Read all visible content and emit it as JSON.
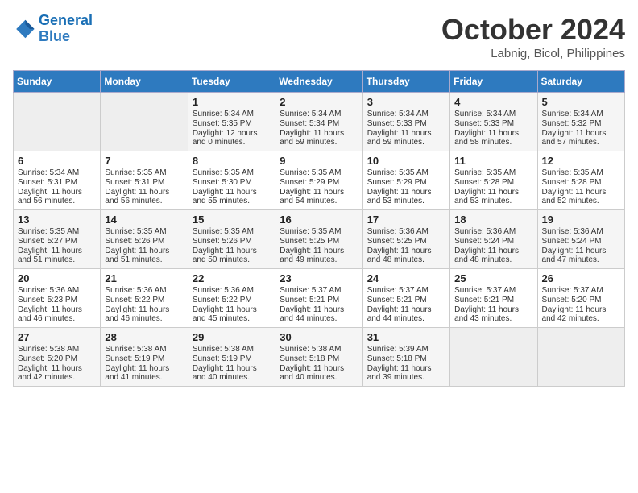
{
  "header": {
    "logo_line1": "General",
    "logo_line2": "Blue",
    "month": "October 2024",
    "location": "Labnig, Bicol, Philippines"
  },
  "weekdays": [
    "Sunday",
    "Monday",
    "Tuesday",
    "Wednesday",
    "Thursday",
    "Friday",
    "Saturday"
  ],
  "weeks": [
    [
      {
        "day": "",
        "info": ""
      },
      {
        "day": "",
        "info": ""
      },
      {
        "day": "1",
        "info": "Sunrise: 5:34 AM\nSunset: 5:35 PM\nDaylight: 12 hours and 0 minutes."
      },
      {
        "day": "2",
        "info": "Sunrise: 5:34 AM\nSunset: 5:34 PM\nDaylight: 11 hours and 59 minutes."
      },
      {
        "day": "3",
        "info": "Sunrise: 5:34 AM\nSunset: 5:33 PM\nDaylight: 11 hours and 59 minutes."
      },
      {
        "day": "4",
        "info": "Sunrise: 5:34 AM\nSunset: 5:33 PM\nDaylight: 11 hours and 58 minutes."
      },
      {
        "day": "5",
        "info": "Sunrise: 5:34 AM\nSunset: 5:32 PM\nDaylight: 11 hours and 57 minutes."
      }
    ],
    [
      {
        "day": "6",
        "info": "Sunrise: 5:34 AM\nSunset: 5:31 PM\nDaylight: 11 hours and 56 minutes."
      },
      {
        "day": "7",
        "info": "Sunrise: 5:35 AM\nSunset: 5:31 PM\nDaylight: 11 hours and 56 minutes."
      },
      {
        "day": "8",
        "info": "Sunrise: 5:35 AM\nSunset: 5:30 PM\nDaylight: 11 hours and 55 minutes."
      },
      {
        "day": "9",
        "info": "Sunrise: 5:35 AM\nSunset: 5:29 PM\nDaylight: 11 hours and 54 minutes."
      },
      {
        "day": "10",
        "info": "Sunrise: 5:35 AM\nSunset: 5:29 PM\nDaylight: 11 hours and 53 minutes."
      },
      {
        "day": "11",
        "info": "Sunrise: 5:35 AM\nSunset: 5:28 PM\nDaylight: 11 hours and 53 minutes."
      },
      {
        "day": "12",
        "info": "Sunrise: 5:35 AM\nSunset: 5:28 PM\nDaylight: 11 hours and 52 minutes."
      }
    ],
    [
      {
        "day": "13",
        "info": "Sunrise: 5:35 AM\nSunset: 5:27 PM\nDaylight: 11 hours and 51 minutes."
      },
      {
        "day": "14",
        "info": "Sunrise: 5:35 AM\nSunset: 5:26 PM\nDaylight: 11 hours and 51 minutes."
      },
      {
        "day": "15",
        "info": "Sunrise: 5:35 AM\nSunset: 5:26 PM\nDaylight: 11 hours and 50 minutes."
      },
      {
        "day": "16",
        "info": "Sunrise: 5:35 AM\nSunset: 5:25 PM\nDaylight: 11 hours and 49 minutes."
      },
      {
        "day": "17",
        "info": "Sunrise: 5:36 AM\nSunset: 5:25 PM\nDaylight: 11 hours and 48 minutes."
      },
      {
        "day": "18",
        "info": "Sunrise: 5:36 AM\nSunset: 5:24 PM\nDaylight: 11 hours and 48 minutes."
      },
      {
        "day": "19",
        "info": "Sunrise: 5:36 AM\nSunset: 5:24 PM\nDaylight: 11 hours and 47 minutes."
      }
    ],
    [
      {
        "day": "20",
        "info": "Sunrise: 5:36 AM\nSunset: 5:23 PM\nDaylight: 11 hours and 46 minutes."
      },
      {
        "day": "21",
        "info": "Sunrise: 5:36 AM\nSunset: 5:22 PM\nDaylight: 11 hours and 46 minutes."
      },
      {
        "day": "22",
        "info": "Sunrise: 5:36 AM\nSunset: 5:22 PM\nDaylight: 11 hours and 45 minutes."
      },
      {
        "day": "23",
        "info": "Sunrise: 5:37 AM\nSunset: 5:21 PM\nDaylight: 11 hours and 44 minutes."
      },
      {
        "day": "24",
        "info": "Sunrise: 5:37 AM\nSunset: 5:21 PM\nDaylight: 11 hours and 44 minutes."
      },
      {
        "day": "25",
        "info": "Sunrise: 5:37 AM\nSunset: 5:21 PM\nDaylight: 11 hours and 43 minutes."
      },
      {
        "day": "26",
        "info": "Sunrise: 5:37 AM\nSunset: 5:20 PM\nDaylight: 11 hours and 42 minutes."
      }
    ],
    [
      {
        "day": "27",
        "info": "Sunrise: 5:38 AM\nSunset: 5:20 PM\nDaylight: 11 hours and 42 minutes."
      },
      {
        "day": "28",
        "info": "Sunrise: 5:38 AM\nSunset: 5:19 PM\nDaylight: 11 hours and 41 minutes."
      },
      {
        "day": "29",
        "info": "Sunrise: 5:38 AM\nSunset: 5:19 PM\nDaylight: 11 hours and 40 minutes."
      },
      {
        "day": "30",
        "info": "Sunrise: 5:38 AM\nSunset: 5:18 PM\nDaylight: 11 hours and 40 minutes."
      },
      {
        "day": "31",
        "info": "Sunrise: 5:39 AM\nSunset: 5:18 PM\nDaylight: 11 hours and 39 minutes."
      },
      {
        "day": "",
        "info": ""
      },
      {
        "day": "",
        "info": ""
      }
    ]
  ]
}
